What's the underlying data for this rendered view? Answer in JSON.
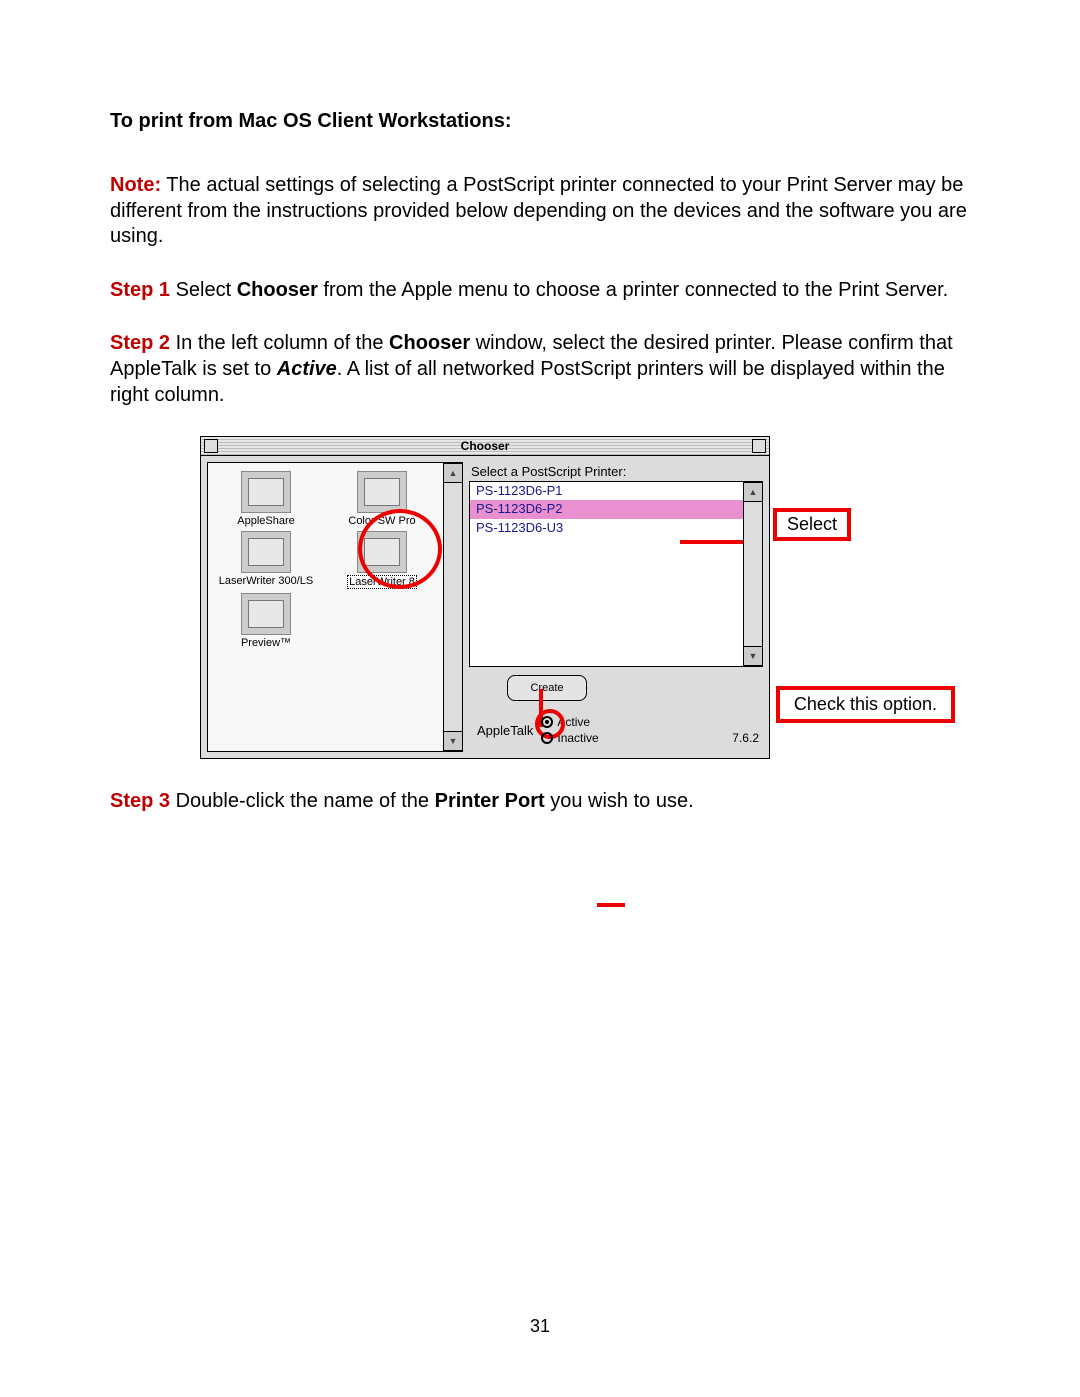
{
  "heading": "To print from Mac OS Client Workstations:",
  "note": {
    "label": "Note:",
    "text": " The actual settings of selecting a PostScript printer connected to your Print Server may be different from the instructions provided below depending on the devices and the software you are using."
  },
  "step1": {
    "label": "Step 1",
    "pre": " Select ",
    "b1": "Chooser",
    "post": " from the Apple menu to choose a printer connected to the Print Server."
  },
  "step2": {
    "label": "Step 2",
    "pre": " In the left column of the ",
    "b1": "Chooser",
    "mid1": " window, select the desired printer.  Please confirm that AppleTalk is set to ",
    "ib1": "Active",
    "post": ".  A list of all networked PostScript printers will be displayed within the right column."
  },
  "step3": {
    "label": "Step 3",
    "pre": " Double-click the name of the ",
    "b1": "Printer Port",
    "post": " you wish to use."
  },
  "pagenum": "31",
  "chooser": {
    "title": "Chooser",
    "left_items": [
      {
        "label": "AppleShare"
      },
      {
        "label": "Color SW Pro"
      },
      {
        "label": "LaserWriter 300/LS"
      },
      {
        "label": "LaserWriter 8",
        "selected": true
      },
      {
        "label": "Preview™"
      }
    ],
    "list_label": "Select a PostScript Printer:",
    "printers": [
      {
        "name": "PS-1123D6-P1",
        "selected": false
      },
      {
        "name": "PS-1123D6-P2",
        "selected": true
      },
      {
        "name": "PS-1123D6-U3",
        "selected": false
      }
    ],
    "create_btn": "Create",
    "appletalk_label": "AppleTalk",
    "active_label": "Active",
    "inactive_label": "Inactive",
    "version": "7.6.2"
  },
  "callouts": {
    "select": "Select",
    "check": "Check this option."
  }
}
